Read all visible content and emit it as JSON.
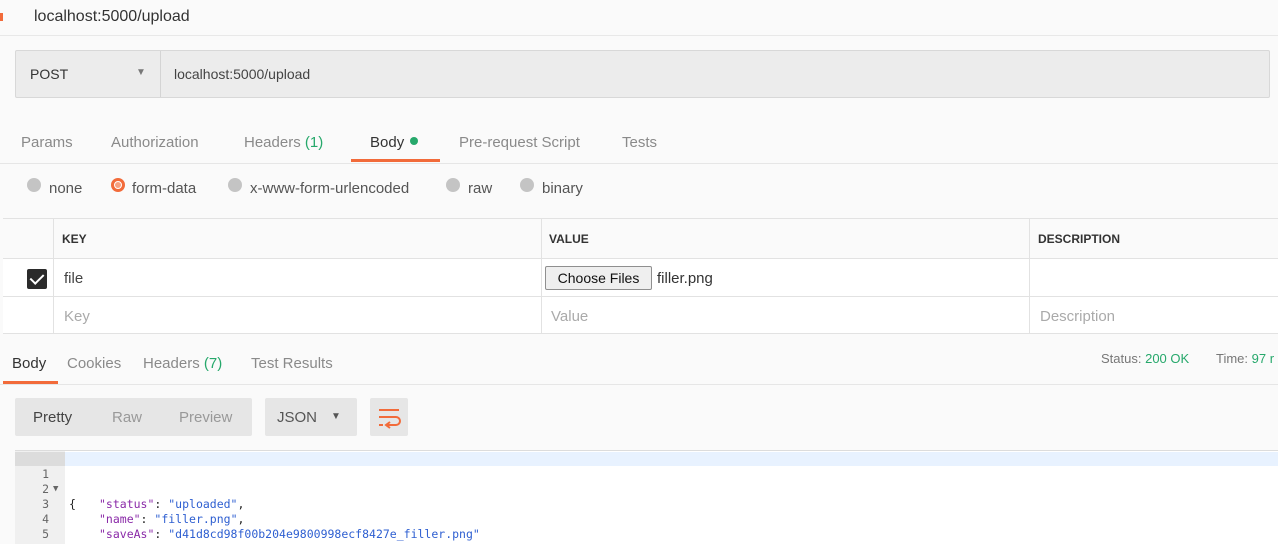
{
  "request_title": "localhost:5000/upload",
  "url_bar": {
    "method": "POST",
    "url": "localhost:5000/upload"
  },
  "request_tabs": [
    {
      "label": "Params"
    },
    {
      "label": "Authorization"
    },
    {
      "label": "Headers",
      "count": "(1)"
    },
    {
      "label": "Body"
    },
    {
      "label": "Pre-request Script"
    },
    {
      "label": "Tests"
    }
  ],
  "body_types": [
    "none",
    "form-data",
    "x-www-form-urlencoded",
    "raw",
    "binary"
  ],
  "body_type_selected": "form-data",
  "kv_table": {
    "headers": {
      "key": "KEY",
      "value": "VALUE",
      "description": "DESCRIPTION"
    },
    "row": {
      "key": "file",
      "file_button": "Choose Files",
      "file_name": "filler.png",
      "checked": true
    },
    "placeholders": {
      "key": "Key",
      "value": "Value",
      "description": "Description"
    }
  },
  "response_tabs": [
    {
      "label": "Body"
    },
    {
      "label": "Cookies"
    },
    {
      "label": "Headers",
      "count": "(7)"
    },
    {
      "label": "Test Results"
    }
  ],
  "status": {
    "label": "Status:",
    "value": "200 OK",
    "time_label": "Time:",
    "time_value": "97 r"
  },
  "view_modes": [
    "Pretty",
    "Raw",
    "Preview"
  ],
  "format": "JSON",
  "icons": {
    "wrap": "wrap-lines-icon",
    "dropdown": "chevron-down-icon"
  },
  "colors": {
    "accent": "#f26b3a",
    "success": "#26a86b"
  },
  "response_body": {
    "line_numbers": [
      "1",
      "2",
      "3",
      "4",
      "5"
    ],
    "open_brace": "{",
    "close_brace": "}",
    "fields": [
      {
        "key": "\"status\"",
        "value": "\"uploaded\"",
        "sep": ": ",
        "trail": ","
      },
      {
        "key": "\"name\"",
        "value": "\"filler.png\"",
        "sep": ": ",
        "trail": ","
      },
      {
        "key": "\"saveAs\"",
        "value": "\"d41d8cd98f00b204e9800998ecf8427e_filler.png\"",
        "sep": ": ",
        "trail": ""
      }
    ]
  }
}
